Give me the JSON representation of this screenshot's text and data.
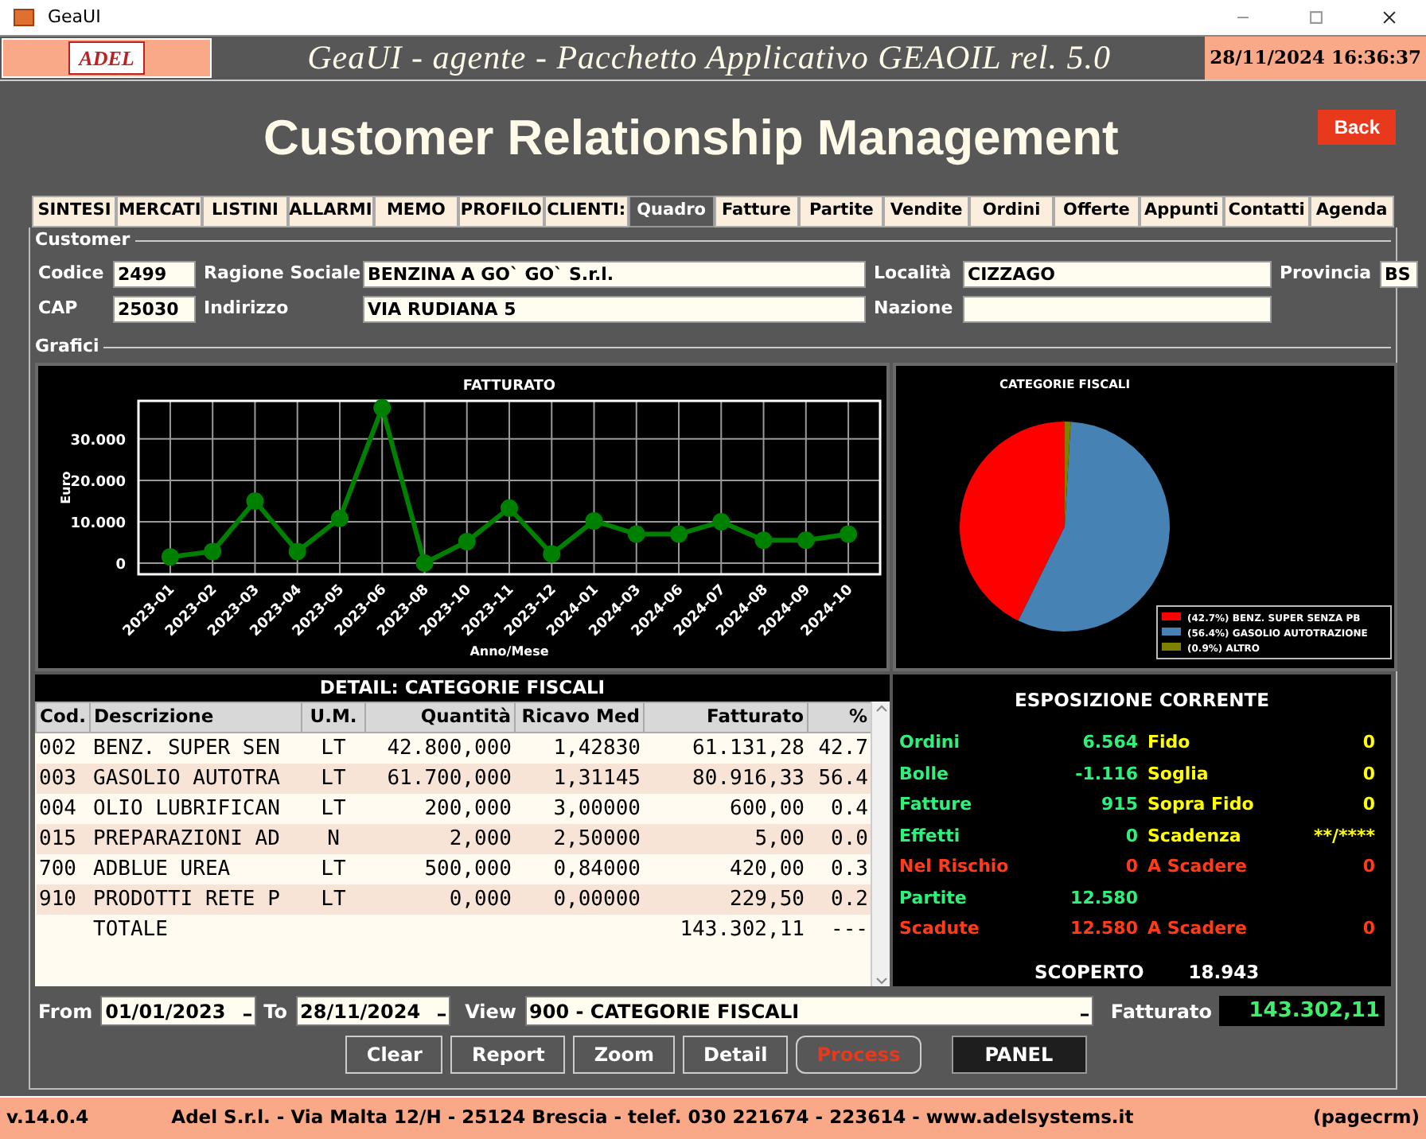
{
  "window": {
    "title": "GeaUI"
  },
  "header": {
    "logo": "ADEL",
    "title": "GeaUI - agente - Pacchetto Applicativo GEAOIL rel. 5.0",
    "datetime": "28/11/2024 16:36:37"
  },
  "page": {
    "title": "Customer Relationship Management",
    "back": "Back"
  },
  "tabs": [
    {
      "label": "SINTESI",
      "selected": false
    },
    {
      "label": "MERCATI",
      "selected": false
    },
    {
      "label": "LISTINI",
      "selected": false
    },
    {
      "label": "ALLARMI",
      "selected": false
    },
    {
      "label": "MEMO",
      "selected": false
    },
    {
      "label": "PROFILO",
      "selected": false
    },
    {
      "label": "CLIENTI:",
      "selected": false
    },
    {
      "label": "Quadro",
      "selected": true
    },
    {
      "label": "Fatture",
      "selected": false
    },
    {
      "label": "Partite",
      "selected": false
    },
    {
      "label": "Vendite",
      "selected": false
    },
    {
      "label": "Ordini",
      "selected": false
    },
    {
      "label": "Offerte",
      "selected": false
    },
    {
      "label": "Appunti",
      "selected": false
    },
    {
      "label": "Contatti",
      "selected": false
    },
    {
      "label": "Agenda",
      "selected": false
    }
  ],
  "customer": {
    "legend": "Customer",
    "rows": [
      [
        {
          "label": "Codice",
          "value": "2499"
        },
        {
          "label": "Ragione Sociale",
          "value": "BENZINA A GO` GO` S.r.l."
        },
        {
          "label": "Località",
          "value": "CIZZAGO"
        },
        {
          "label": "Provincia",
          "value": "BS"
        }
      ],
      [
        {
          "label": "CAP",
          "value": "25030"
        },
        {
          "label": "Indirizzo",
          "value": "VIA RUDIANA 5"
        },
        {
          "label": "Nazione"
        }
      ]
    ]
  },
  "grafici": {
    "legend": "Grafici",
    "line_chart": {
      "chart_data": {
        "type": "line",
        "title": "FATTURATO",
        "xlabel": "Anno/Mese",
        "ylabel": "Euro",
        "categories": [
          "2023-01",
          "2023-02",
          "2023-03",
          "2023-04",
          "2023-05",
          "2023-06",
          "2023-08",
          "2023-10",
          "2023-11",
          "2023-12",
          "2024-01",
          "2024-03",
          "2024-06",
          "2024-07",
          "2024-08",
          "2024-09",
          "2024-10"
        ],
        "grid": true,
        "series": [
          {
            "color": "#008000",
            "marker": "o",
            "values": [
              1500,
              2800,
              15000,
              2800,
              10800,
              37500,
              0,
              5200,
              13300,
              2200,
              10200,
              7000,
              7000,
              10000,
              5500,
              5500,
              7000
            ]
          }
        ],
        "ylim": [
          -2700,
          39200
        ],
        "yticks": [
          {
            "value": 0,
            "label": "0"
          },
          {
            "value": 10000,
            "label": "10.000"
          },
          {
            "value": 20000,
            "label": "20.000"
          },
          {
            "value": 30000,
            "label": "30.000"
          }
        ]
      }
    },
    "pie_chart": {
      "chart_data": {
        "type": "pie",
        "title": "CATEGORIE FISCALI",
        "categories": [
          "(42.7%) BENZ. SUPER SENZA PB",
          "(56.4%) GASOLIO AUTOTRAZIONE",
          "(0.9%) ALTRO"
        ],
        "legend": true,
        "series": [
          {
            "values": [
              42.7,
              56.4,
              0.9
            ],
            "colors": [
              "#ff0000",
              "#4682b4",
              "#808000"
            ]
          }
        ]
      }
    },
    "detail": {
      "title": "DETAIL: CATEGORIE FISCALI",
      "columns": [
        "Cod.",
        "Descrizione",
        "U.M.",
        "Quantità",
        "Ricavo Med",
        "Fatturato",
        "%"
      ],
      "rows": [
        [
          "002",
          "BENZ. SUPER SEN",
          "LT",
          "42.800,000",
          "1,42830",
          "61.131,28",
          "42.7"
        ],
        [
          "003",
          "GASOLIO AUTOTRA",
          "LT",
          "61.700,000",
          "1,31145",
          "80.916,33",
          "56.4"
        ],
        [
          "004",
          "OLIO LUBRIFICAN",
          "LT",
          "200,000",
          "3,00000",
          "600,00",
          "0.4"
        ],
        [
          "015",
          "PREPARAZIONI AD",
          "N",
          "2,000",
          "2,50000",
          "5,00",
          "0.0"
        ],
        [
          "700",
          "ADBLUE UREA",
          "LT",
          "500,000",
          "0,84000",
          "420,00",
          "0.3"
        ],
        [
          "910",
          "PRODOTTI RETE P",
          "LT",
          "0,000",
          "0,00000",
          "229,50",
          "0.2"
        ]
      ],
      "total": {
        "label": "TOTALE",
        "fatturato": "143.302,11",
        "percent": "---"
      }
    },
    "exposure": {
      "title": "ESPOSIZIONE CORRENTE",
      "rows": [
        {
          "left": {
            "label": "Ordini",
            "value": "6.564",
            "color": "#2ef07a"
          },
          "right": {
            "label": "Fido",
            "value": "0",
            "color": "#ffff00"
          }
        },
        {
          "left": {
            "label": "Bolle",
            "value": "-1.116",
            "color": "#2ef07a"
          },
          "right": {
            "label": "Soglia",
            "value": "0",
            "color": "#ffff00"
          }
        },
        {
          "left": {
            "label": "Fatture",
            "value": "915",
            "color": "#2ef07a"
          },
          "right": {
            "label": "Sopra Fido",
            "value": "0",
            "color": "#ffff00"
          }
        },
        {
          "left": {
            "label": "Effetti",
            "value": "0",
            "color": "#2ef07a"
          },
          "right": {
            "label": "Scadenza",
            "value": "**/****",
            "color": "#ffff00"
          }
        },
        {
          "left": {
            "label": "Nel Rischio",
            "value": "0",
            "color": "#ff3b1a"
          },
          "right": {
            "label": "A Scadere",
            "value": "0",
            "color": "#ff3b1a"
          }
        },
        {
          "left": {
            "label": "Partite",
            "value": "12.580",
            "color": "#2ef07a"
          }
        },
        {
          "left": {
            "label": "Scadute",
            "value": "12.580",
            "color": "#ff3b1a"
          },
          "right": {
            "label": "A Scadere",
            "value": "0",
            "color": "#ff3b1a"
          }
        }
      ],
      "total": {
        "label": "SCOPERTO",
        "value": "18.943"
      }
    }
  },
  "filters": {
    "from_label": "From",
    "from": "01/01/2023",
    "to_label": "To",
    "to": "28/11/2024",
    "view_label": "View",
    "view": "900 - CATEGORIE FISCALI",
    "total_label": "Fatturato",
    "total": "143.302,11"
  },
  "buttons": [
    {
      "label": "Clear",
      "kind": "normal"
    },
    {
      "label": "Report",
      "kind": "normal"
    },
    {
      "label": "Zoom",
      "kind": "normal"
    },
    {
      "label": "Detail",
      "kind": "normal"
    },
    {
      "label": "Process",
      "kind": "alert"
    },
    {
      "label": "PANEL",
      "kind": "dark"
    }
  ],
  "footer": {
    "version": "v.14.0.4",
    "company": "Adel S.r.l. - Via Malta 12/H - 25124 Brescia - telef. 030 221674 - 223614 - www.adelsystems.it",
    "page": "(pagecrm)"
  }
}
